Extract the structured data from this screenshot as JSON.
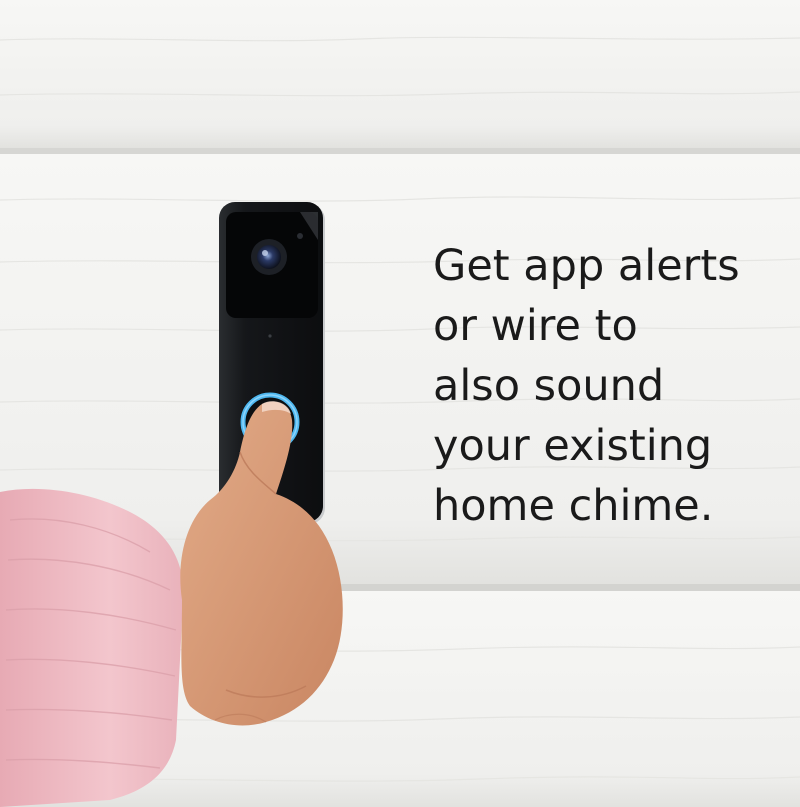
{
  "caption": {
    "lines": [
      "Get app alerts",
      "or wire to",
      "also sound",
      "your existing",
      "home chime."
    ]
  },
  "colors": {
    "siding": "#f1f1ef",
    "siding_shadow": "#d9d9d6",
    "doorbell_body": "#121416",
    "button_ring": "#4fb8f0",
    "sleeve": "#efbcc4",
    "skin": "#d89c78",
    "text": "#1a1a1a"
  },
  "scene": {
    "objects": [
      "white-siding-wall",
      "video-doorbell",
      "hand-pressing-button",
      "pink-sleeve"
    ]
  }
}
